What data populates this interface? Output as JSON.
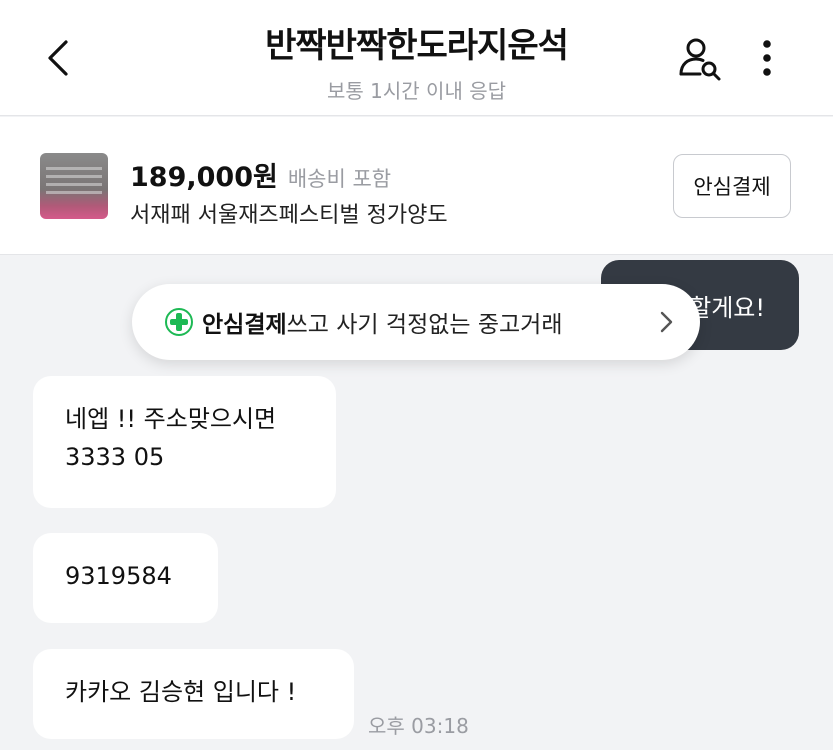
{
  "header": {
    "title": "반짝반짝한도라지운석",
    "subtitle": "보통 1시간 이내 응답",
    "icons": [
      "chevron-left-icon",
      "user-search-icon",
      "more-vertical-icon"
    ]
  },
  "product": {
    "price": "189,000원",
    "shipping": "배송비 포함",
    "name": "서재패 서울재즈페스티벌 정가양도",
    "safe_pay_label": "안심결제"
  },
  "banner": {
    "bold": "안심결제",
    "text": "쓰고 사기 걱정없는 중고거래",
    "accent_color": "#1db954"
  },
  "messages": {
    "outgoing_partial": "할게요!",
    "incoming": [
      {
        "line1": "네엡 !! 주소맞으시면",
        "line2": "3333 05"
      },
      {
        "line1": "9319584"
      },
      {
        "line1": "카카오 김승현 입니다 !"
      }
    ],
    "time": "오후 03:18"
  },
  "colors": {
    "background": "#f2f3f5",
    "dark_bubble": "#343a43"
  }
}
